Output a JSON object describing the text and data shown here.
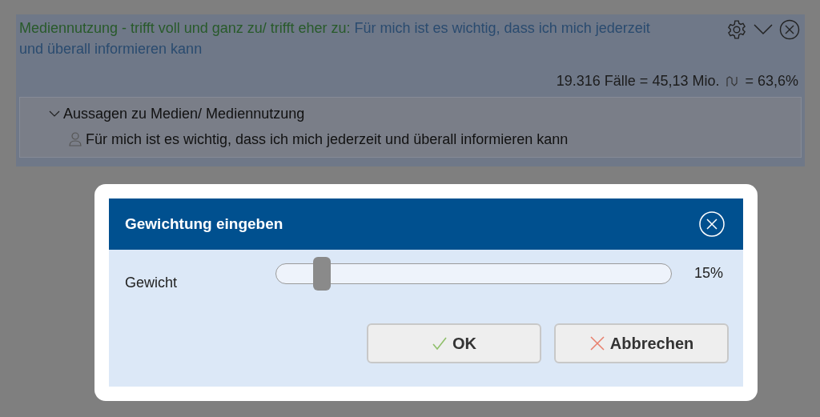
{
  "panel": {
    "title_prefix": "Mediennutzung - trifft voll und ganz zu/ trifft eher zu:",
    "title_rest": "Für mich ist es wichtig, dass ich mich jederzeit und überall informieren kann",
    "cases": "19.316 Fälle = 45,13 Mio.",
    "share": "= 63,6%",
    "tree": [
      {
        "label": "Aussagen zu Medien/ Mediennutzung",
        "expanded": true,
        "children": [
          {
            "label": "Für mich ist es wichtig, dass ich mich jederzeit und überall informieren kann"
          }
        ]
      }
    ]
  },
  "dialog": {
    "title": "Gewichtung eingeben",
    "slider": {
      "label": "Gewicht",
      "level": 0.1,
      "reading": "15%"
    },
    "buttons": [
      {
        "kind": "ok",
        "label": "OK"
      },
      {
        "kind": "cancel",
        "label": "Abbrechen"
      }
    ]
  }
}
